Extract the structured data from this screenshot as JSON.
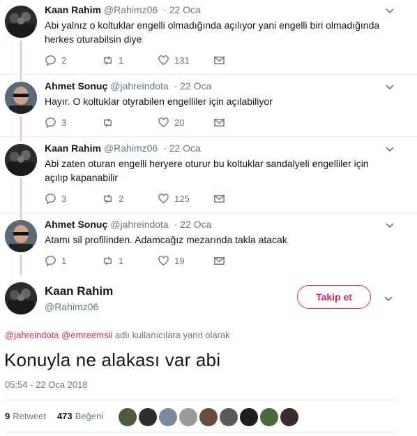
{
  "colors": {
    "accent": "#e0245e",
    "meta": "#657786",
    "text": "#14171a",
    "thread": "#f2b6c6",
    "divider": "#e6ecf0"
  },
  "thread": [
    {
      "author": "Kaan Rahim",
      "handle": "@Rahimz06",
      "date": "· 22 Oca",
      "text_lines": [
        "Abi yalnız o koltuklar engelli olmadığında açılıyor yani engelli biri olmadığında",
        "herkes oturabilsin diye"
      ],
      "replies": "2",
      "retweets": "1",
      "likes": "131"
    },
    {
      "author": "Ahmet Sonuç",
      "handle": "@jahreindota",
      "date": "· 22 Oca",
      "text_lines": [
        "Hayır. O koltuklar otyrabilen engelliler için açılabiliyor"
      ],
      "replies": "3",
      "retweets": "",
      "likes": "20"
    },
    {
      "author": "Kaan Rahim",
      "handle": "@Rahimz06",
      "date": "· 22 Oca",
      "text_lines": [
        "Abi zaten oturan engelli heryere oturur bu koltuklar sandalyeli engelliler için",
        "açılıp kapanabilir"
      ],
      "replies": "3",
      "retweets": "2",
      "likes": "125"
    },
    {
      "author": "Ahmet Sonuç",
      "handle": "@jahreindota",
      "date": "· 22 Oca",
      "text_lines": [
        "Atamı sil profilinden. Adamcağız mezarında takla atacak"
      ],
      "replies": "1",
      "retweets": "1",
      "likes": "19"
    }
  ],
  "main": {
    "author": "Kaan Rahim",
    "handle": "@Rahimz06",
    "follow_label": "Takip et",
    "reply_mention_1": "@jahreindota",
    "reply_mention_2": "@emreemsii",
    "reply_suffix": " adlı kullanıcılara yanıt olarak",
    "text": "Konuyla ne alakası var abi",
    "timestamp": "05:54 - 22 Oca 2018",
    "retweet_count": "9",
    "retweet_label": "Retweet",
    "like_count": "473",
    "like_label": "Beğeni"
  },
  "icons": [
    "reply-icon",
    "retweet-icon",
    "like-icon",
    "message-icon",
    "chevron-down-icon"
  ]
}
